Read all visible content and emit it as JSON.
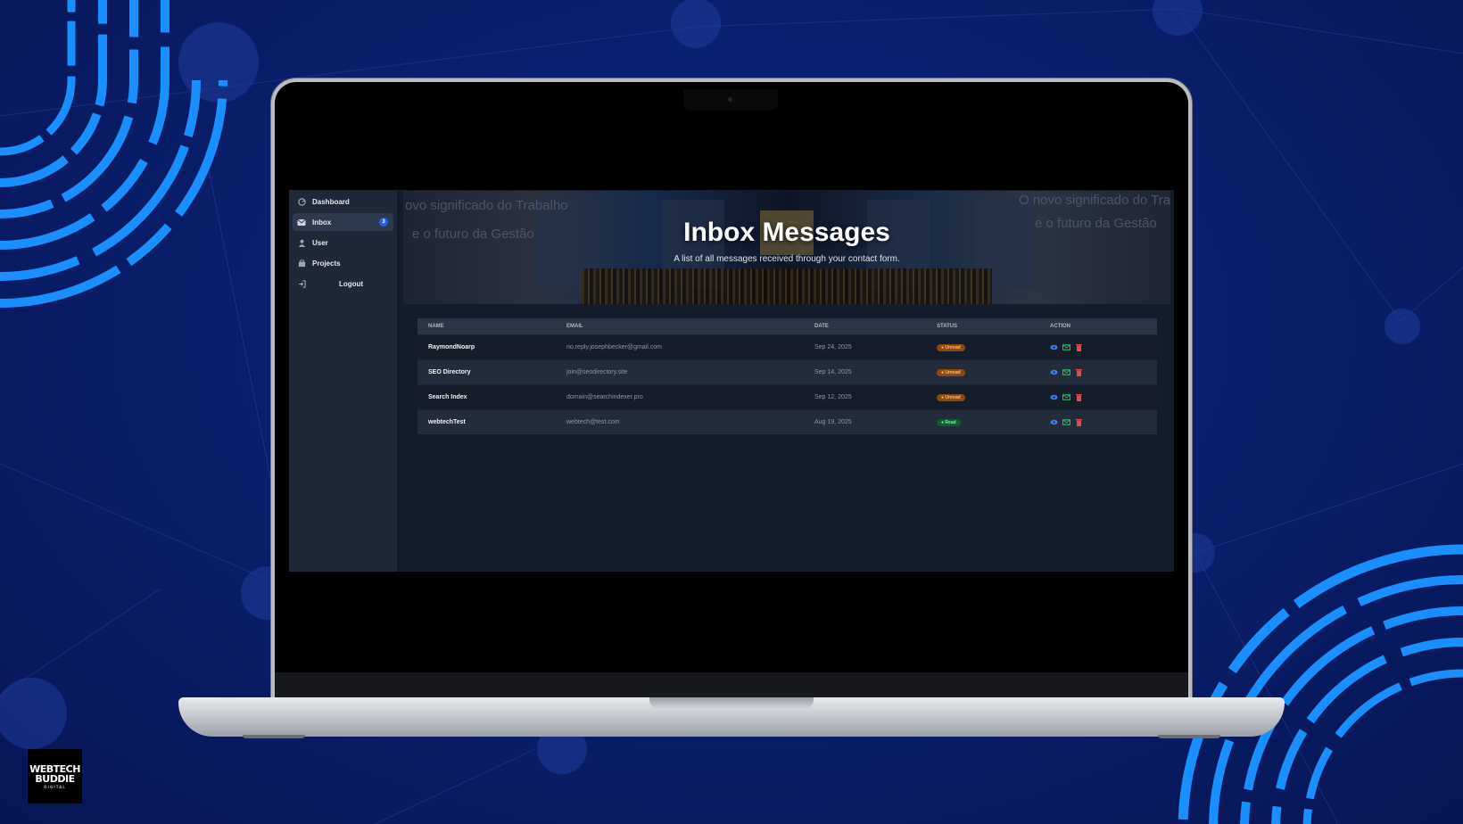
{
  "colors": {
    "accent": "#2b5ce6",
    "unread": "#8a4a12",
    "read": "#0f5a33",
    "background": "#0a1f6e"
  },
  "sidebar": {
    "items": [
      {
        "label": "Dashboard",
        "icon": "dashboard-icon"
      },
      {
        "label": "Inbox",
        "icon": "inbox-icon",
        "badge": "3",
        "active": true
      },
      {
        "label": "User",
        "icon": "user-icon"
      },
      {
        "label": "Projects",
        "icon": "projects-icon"
      },
      {
        "label": "Logout",
        "icon": "logout-icon"
      }
    ]
  },
  "banner": {
    "title": "Inbox Messages",
    "subtitle": "A list of all messages received through your contact form.",
    "bg_text_1": "ovo significado do Trabalho",
    "bg_text_2": "e o futuro da Gestão",
    "bg_text_3": "O novo significado do Trab",
    "bg_text_4": "e o futuro da Gestão"
  },
  "table": {
    "headers": [
      "NAME",
      "EMAIL",
      "DATE",
      "STATUS",
      "ACTION"
    ],
    "rows": [
      {
        "name": "RaymondNoarp",
        "email": "no.reply.josephbecker@gmail.com",
        "date": "Sep 24, 2025",
        "status": "Unread"
      },
      {
        "name": "SEO Directory",
        "email": "join@seodirectory.site",
        "date": "Sep 14, 2025",
        "status": "Unread"
      },
      {
        "name": "Search Index",
        "email": "domain@searchindexer.pro",
        "date": "Sep 12, 2025",
        "status": "Unread"
      },
      {
        "name": "webtechTest",
        "email": "webtech@test.com",
        "date": "Aug 19, 2025",
        "status": "Read"
      }
    ]
  },
  "logo": {
    "line1": "WEBTECH",
    "line2": "BUDDIE",
    "line3": "DIGITAL"
  }
}
